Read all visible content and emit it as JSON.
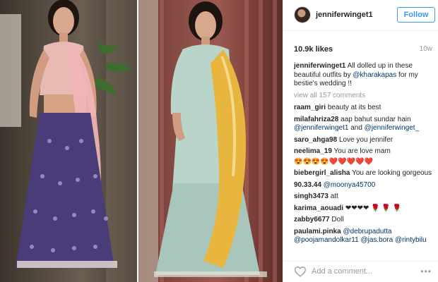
{
  "post": {
    "username": "jenniferwinget1",
    "follow_label": "Follow",
    "likes": "10.9k likes",
    "age": "10w",
    "caption": {
      "user": "jenniferwinget1",
      "text_before": "All dolled up in these beautiful outfits by",
      "mention": "@kharakapas",
      "text_after": "for my bestie's wedding !!"
    },
    "view_all": "view all 157 comments",
    "comments": [
      {
        "user": "raam_giri",
        "text": "beauty at its best"
      },
      {
        "user": "milafahriza28",
        "text": "aap bahut sundar hain",
        "mention": "@jenniferwinget1",
        "text2": "and",
        "mention2": "@jenniferwinget_"
      },
      {
        "user": "saro_ahga98",
        "text": "Love you jennifer"
      },
      {
        "user": "neelima_19",
        "text": "You are love mam"
      },
      {
        "user": "",
        "text": "😍😍😍😍❤️❤️❤️❤️❤️"
      },
      {
        "user": "biebergirl_alisha",
        "text": "You are looking gorgeous"
      },
      {
        "user": "90.33.44",
        "mention": "@moonya45700"
      },
      {
        "user": "singh3473",
        "text": "att"
      },
      {
        "user": "karima_aouadi",
        "text": "❤❤❤❤ 🌹 🌹 🌹"
      },
      {
        "user": "zabby6677",
        "text": "Doll"
      },
      {
        "user": "paulami.pinka",
        "mention": "@debrupadutta"
      },
      {
        "user": "",
        "mention": "@poojamandolkar11 @jas.bora @rintybilu"
      }
    ],
    "add_comment_placeholder": "Add a comment...",
    "more_icon": "•••"
  },
  "colors": {
    "accent": "#3897f0",
    "link": "#003569",
    "muted": "#999999"
  }
}
